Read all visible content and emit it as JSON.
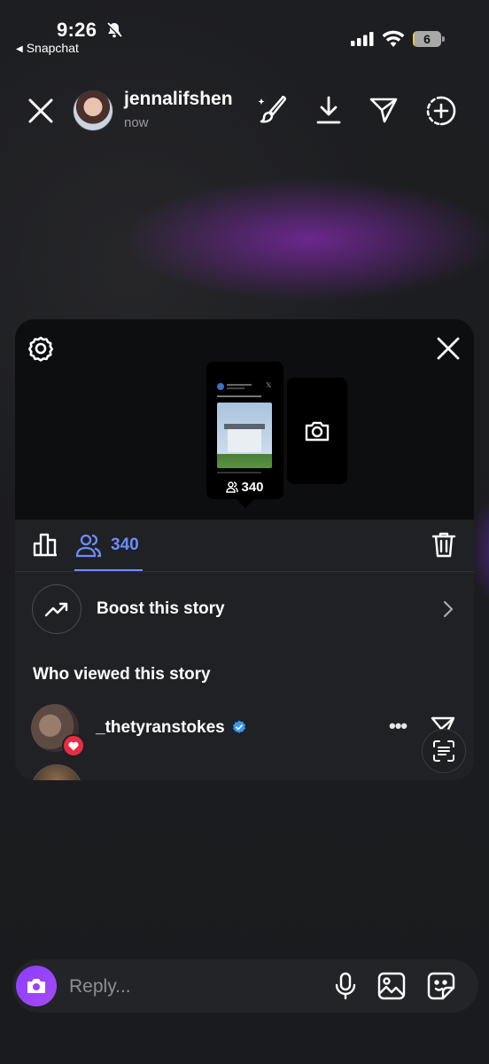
{
  "status_bar": {
    "time": "9:26",
    "back_app": "Snapchat",
    "battery_level": "6",
    "battery_color": "#e7c64a"
  },
  "story": {
    "username": "jennalifshen",
    "timestamp": "now"
  },
  "panel": {
    "viewer_count": "340",
    "tab_count": "340",
    "boost_label": "Boost this story",
    "section_title": "Who viewed this story",
    "viewers": [
      {
        "name": "_thetyranstokes",
        "verified": true,
        "reaction": "heart"
      }
    ],
    "accent_color": "#6d8cff"
  },
  "reply": {
    "placeholder": "Reply..."
  },
  "icons": [
    "close-icon",
    "brush-icon",
    "download-icon",
    "send-icon",
    "add-story-icon",
    "gear-icon",
    "insights-icon",
    "viewers-icon",
    "trash-icon",
    "trending-up-icon",
    "chevron-right-icon",
    "camera-icon",
    "more-icon",
    "scan-text-icon",
    "microphone-icon",
    "gallery-icon",
    "sticker-icon",
    "verified-icon",
    "heart-icon"
  ]
}
